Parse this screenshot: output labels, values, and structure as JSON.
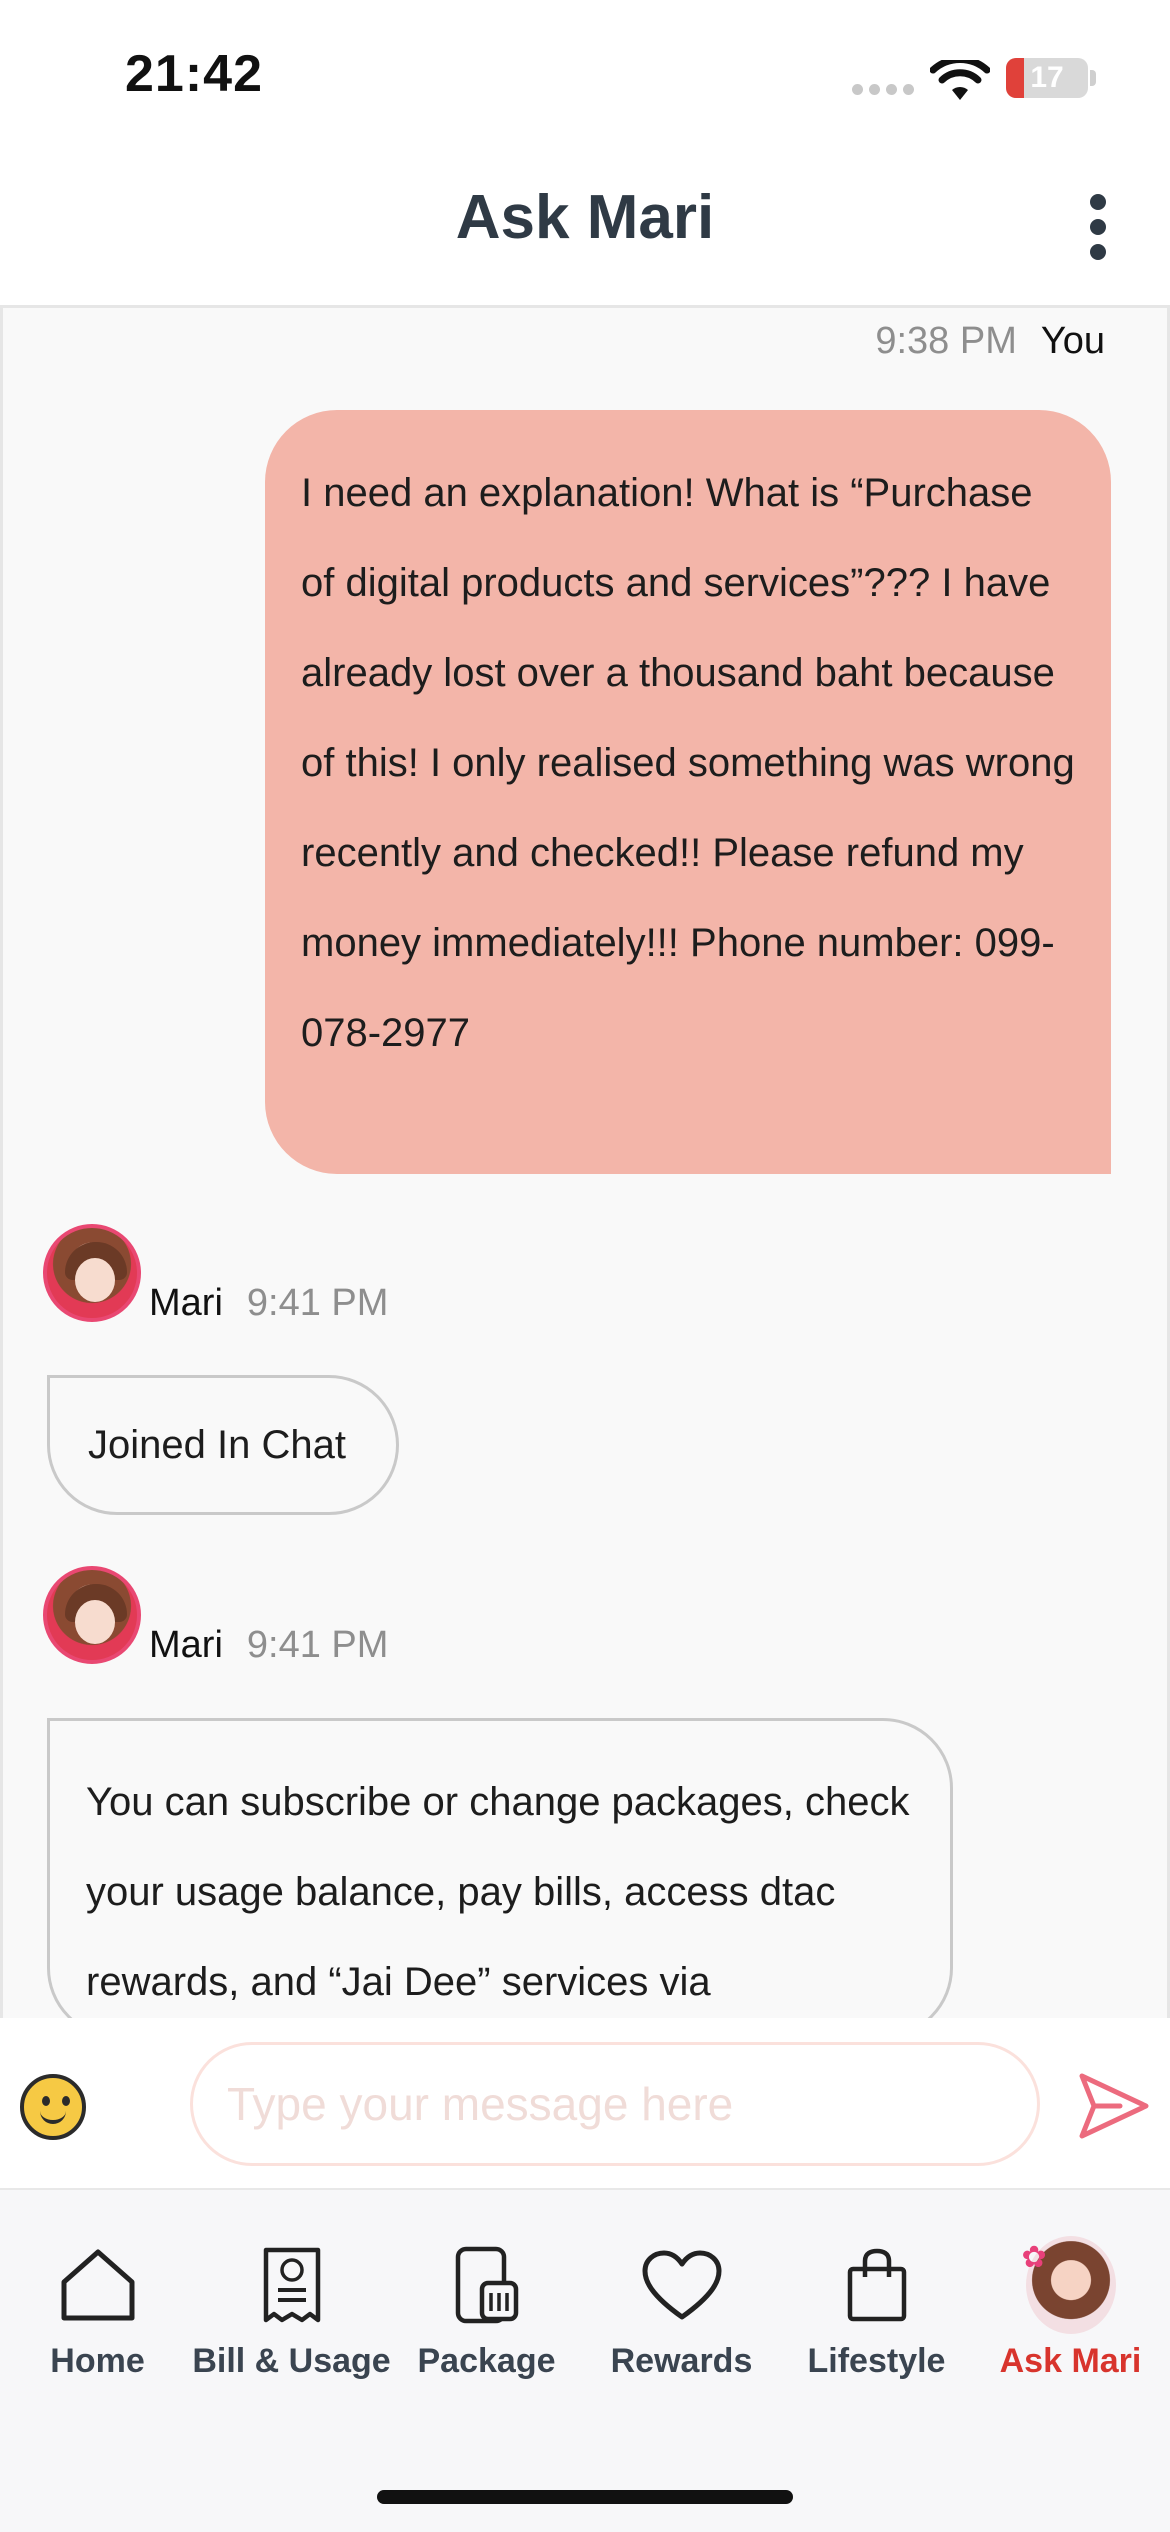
{
  "status_bar": {
    "time": "21:42",
    "battery_level": "17",
    "battery_color": "#e0413a"
  },
  "header": {
    "title": "Ask Mari",
    "menu_icon": "more-vertical-icon"
  },
  "chat": {
    "messages": [
      {
        "sender": "You",
        "time": "9:38 PM",
        "text": "I need an explanation! What is “Purchase of digital products and services”??? I have already lost over a thousand baht because of this! I only realised something was wrong recently and checked!! Please refund my money immediately!!! Phone number: 099-078-2977"
      },
      {
        "sender": "Mari",
        "time": "9:41 PM",
        "text": "Joined In Chat"
      },
      {
        "sender": "Mari",
        "time": "9:41 PM",
        "text": "You can subscribe or change packages, check your usage balance, pay bills, access dtac rewards, and “Jai Dee” services via"
      }
    ],
    "user_bubble_color": "#f3b5a9"
  },
  "composer": {
    "placeholder": "Type your message here",
    "emoji_icon": "smiley-icon",
    "send_icon": "send-icon"
  },
  "tab_bar": {
    "tabs": [
      {
        "label": "Home",
        "icon": "home-icon"
      },
      {
        "label": "Bill & Usage",
        "icon": "bill-icon"
      },
      {
        "label": "Package",
        "icon": "sim-card-icon"
      },
      {
        "label": "Rewards",
        "icon": "heart-icon"
      },
      {
        "label": "Lifestyle",
        "icon": "shopping-bag-icon"
      },
      {
        "label": "Ask Mari",
        "icon": "mari-avatar-icon"
      }
    ],
    "active_tab": "Ask Mari",
    "active_color": "#d8342d"
  }
}
